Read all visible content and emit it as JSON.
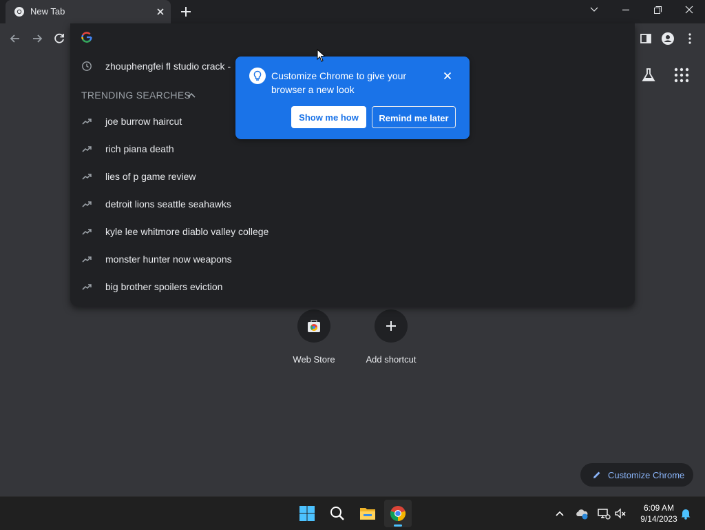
{
  "window": {
    "tab_title": "New Tab"
  },
  "omnibox": {
    "history_item": "zhouphengfei fl studio crack -",
    "trending_header": "TRENDING SEARCHES",
    "trending": [
      {
        "label": "joe burrow haircut"
      },
      {
        "label": "rich piana death"
      },
      {
        "label": "lies of p game review"
      },
      {
        "label": "detroit lions seattle seahawks"
      },
      {
        "label": "kyle lee whitmore diablo valley college"
      },
      {
        "label": "monster hunter now weapons"
      },
      {
        "label": "big brother spoilers eviction"
      }
    ]
  },
  "popup": {
    "message": "Customize Chrome to give your browser a new look",
    "show_button": "Show me how",
    "remind_button": "Remind me later"
  },
  "shortcuts": {
    "web_store": "Web Store",
    "add_shortcut": "Add shortcut"
  },
  "customize_button": "Customize Chrome",
  "taskbar": {
    "time": "6:09 AM",
    "date": "9/14/2023"
  },
  "colors": {
    "accent": "#1a73e8",
    "background": "#35363a",
    "omnibox": "#202124",
    "link": "#8ab4f8"
  },
  "icons": [
    "chrome-icon",
    "close-icon",
    "plus-icon",
    "chevron-down-icon",
    "minimize-icon",
    "restore-icon",
    "back-icon",
    "forward-icon",
    "reload-icon",
    "google-g-icon",
    "history-icon",
    "trending-icon",
    "chevron-up-icon",
    "side-panel-icon",
    "profile-icon",
    "kebab-menu-icon",
    "labs-flask-icon",
    "apps-grid-icon",
    "lightbulb-icon",
    "pencil-icon",
    "windows-start-icon",
    "search-icon",
    "file-explorer-icon",
    "onedrive-icon",
    "network-icon",
    "volume-muted-icon",
    "notification-bell-icon"
  ]
}
